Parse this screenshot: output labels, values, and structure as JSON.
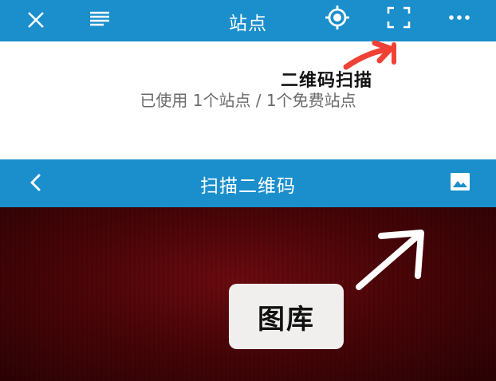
{
  "site_bar": {
    "title": "站点",
    "icons": {
      "close": "close-icon",
      "menu": "menu-icon",
      "locate": "locate-icon",
      "scan": "qr-scan-icon",
      "more": "more-icon"
    },
    "background": "#1a8fcb"
  },
  "site_panel": {
    "usage_text": "已使用 1个站点 / 1个免费站点"
  },
  "annotations": {
    "qr_scan_label": "二维码扫描",
    "gallery_label": "图库",
    "arrow_color_red": "#ef4136",
    "arrow_color_white": "#ffffff"
  },
  "scan_bar": {
    "title": "扫描二维码",
    "icons": {
      "back": "back-icon",
      "gallery": "gallery-icon"
    }
  },
  "camera": {
    "background": "#4a0508"
  }
}
